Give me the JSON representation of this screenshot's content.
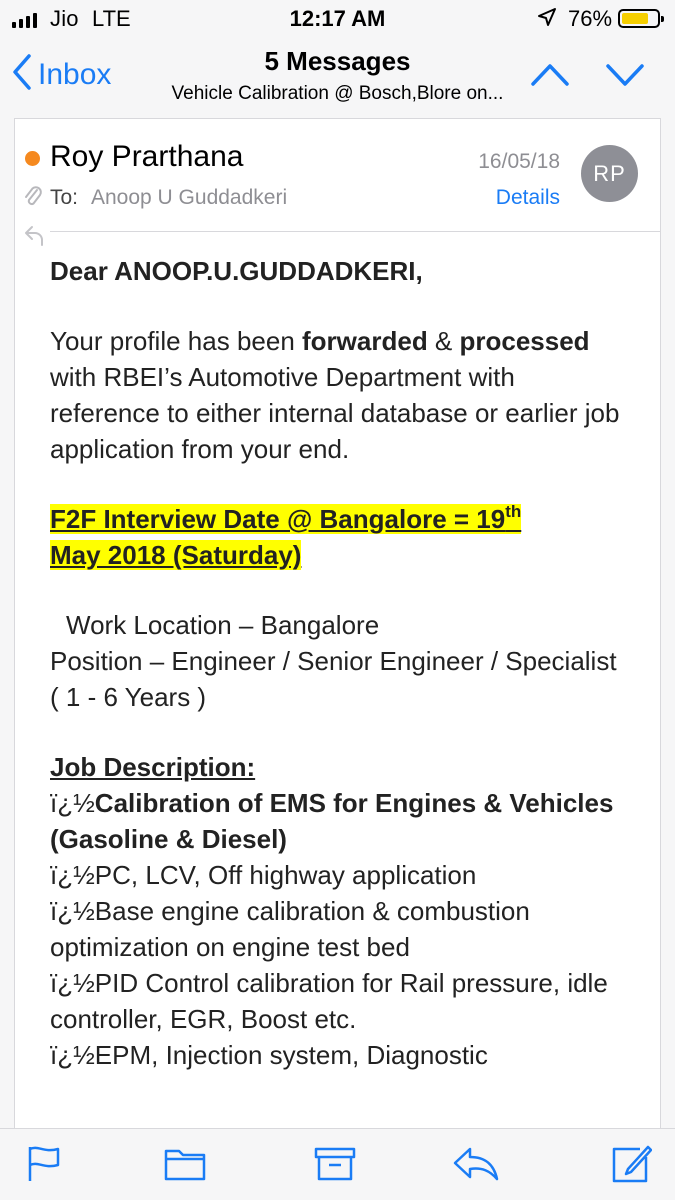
{
  "status_bar": {
    "carrier": "Jio",
    "network": "LTE",
    "time": "12:17 AM",
    "battery": "76%",
    "battery_level": 0.76,
    "icons": [
      "signal-bars-icon",
      "location-arrow-icon",
      "battery-icon"
    ]
  },
  "nav": {
    "back_label": "Inbox",
    "title": "5 Messages",
    "subject": "Vehicle Calibration @ Bosch,Blore on...",
    "icons": [
      "chevron-left-icon",
      "chevron-up-icon",
      "chevron-down-icon"
    ]
  },
  "message": {
    "sender": "Roy Prarthana",
    "date": "16/05/18",
    "avatar_initials": "RP",
    "to_label": "To:",
    "to_name": "Anoop U Guddadkeri",
    "details_label": "Details",
    "unread_dot_color": "#f5891f",
    "body": {
      "greeting": "Dear ANOOP.U.GUDDADKERI,",
      "intro_1": "Your profile has been ",
      "intro_bold_1": "forwarded",
      "intro_2": " & ",
      "intro_bold_2": "processed",
      "intro_3": " with RBEI’s Automotive Department with reference to either internal database or earlier job application from your end.",
      "interview_1": "F2F Interview Date @ Bangalore = 19",
      "interview_sup": "th",
      "interview_2": "May 2018 (Saturday)",
      "work_location": "Work Location – Bangalore",
      "position": "Position – Engineer / Senior Engineer / Specialist ( 1 - 6 Years )",
      "jd_title": "Job Description:",
      "bullet_prefix": "ï¿½",
      "jd_items": [
        {
          "text": "Calibration of EMS for Engines & Vehicles (Gasoline & Diesel)",
          "bold": true
        },
        {
          "text": "PC, LCV, Off highway application",
          "bold": false
        },
        {
          "text": "Base engine calibration & combustion optimization on engine test bed",
          "bold": false
        },
        {
          "text": "PID Control calibration for Rail pressure, idle controller, EGR, Boost etc.",
          "bold": false
        },
        {
          "text": "EPM, Injection system, Diagnostic",
          "bold": false
        }
      ]
    }
  },
  "toolbar": {
    "icons": [
      "flag-icon",
      "folder-icon",
      "archive-icon",
      "reply-icon",
      "compose-icon"
    ]
  },
  "colors": {
    "accent": "#1a7cf5",
    "highlight": "#ffff00",
    "avatar_bg": "#8e8f96"
  }
}
